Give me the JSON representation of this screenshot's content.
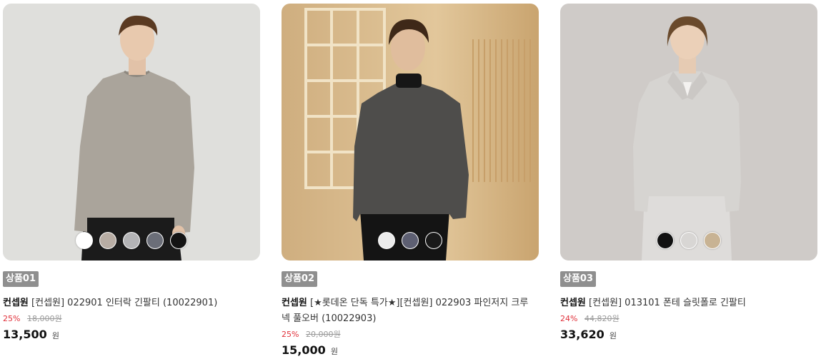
{
  "products": [
    {
      "badge": "상품01",
      "brand": "컨셉원",
      "name": "[컨셉원] 022901 인터락 긴팔티 (10022901)",
      "discount": "25%",
      "original_price": "18,000원",
      "price": "13,500",
      "currency": "원",
      "model": "man in taupe long-sleeve tee, black pants",
      "swatches": [
        "#ffffff",
        "#b8ada4",
        "#b4b4b6",
        "#6b6e78",
        "#141414"
      ]
    },
    {
      "badge": "상품02",
      "brand": "컨셉원",
      "name": "[★롯데온 단독 특가★][컨셉원] 022903 파인저지 크루넥 풀오버 (10022903)",
      "discount": "25%",
      "original_price": "20,000원",
      "price": "15,000",
      "currency": "원",
      "model": "man in charcoal crewneck over black mock neck",
      "swatches": [
        "#ececec",
        "#5d5f72",
        "#1a1a1a"
      ]
    },
    {
      "badge": "상품03",
      "brand": "컨셉원",
      "name": "[컨셉원] 013101 폰테 슬릿폴로 긴팔티",
      "discount": "24%",
      "original_price": "44,820원",
      "price": "33,620",
      "currency": "원",
      "model": "man in light grey slit polo and light pants",
      "swatches": [
        "#111111",
        "#d8d6d4",
        "#c8b394"
      ]
    }
  ]
}
